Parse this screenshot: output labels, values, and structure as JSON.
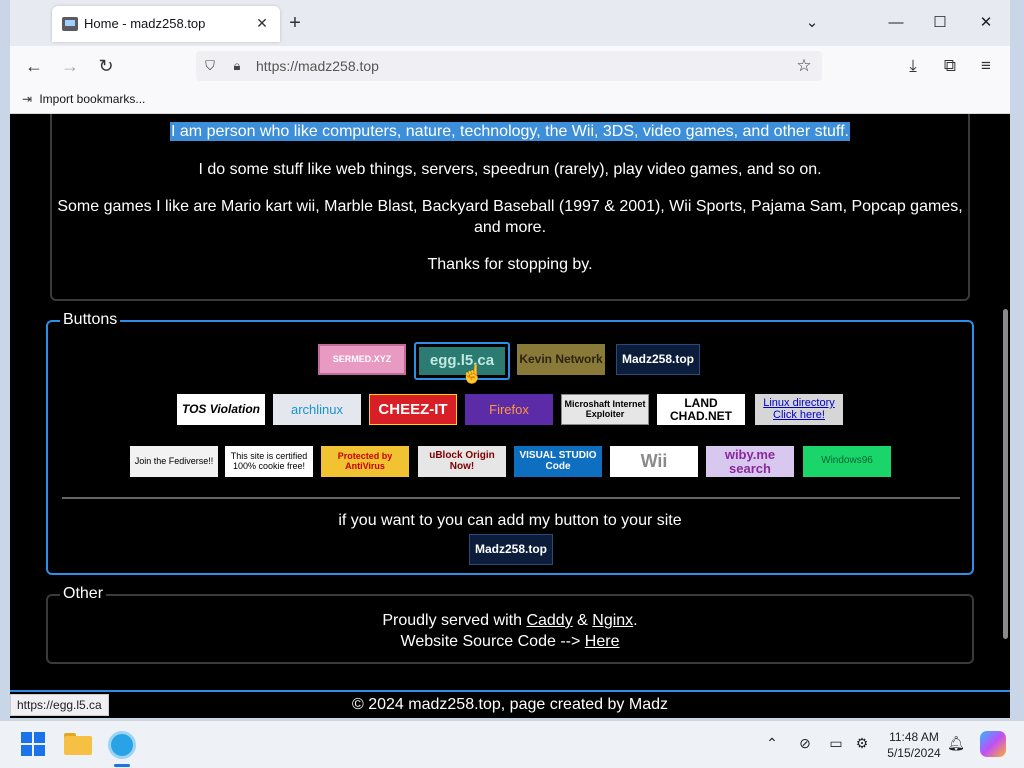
{
  "browser": {
    "tab_title": "Home - madz258.top",
    "tab_close": "✕",
    "new_tab": "+",
    "url": "https://madz258.top",
    "bookmark_item": "Import bookmarks...",
    "window_controls": {
      "list": "⌄",
      "minimize": "—",
      "maximize": "☐",
      "close": "✕"
    },
    "nav": {
      "back": "←",
      "forward": "→",
      "reload": "↻"
    },
    "status_link": "https://egg.l5.ca"
  },
  "page": {
    "about": {
      "line1": "I am person who like computers, nature, technology, the Wii, 3DS, video games, and other stuff.",
      "line2": "I do some stuff like web things, servers, speedrun (rarely), play video games, and so on.",
      "line3a": "Some games I like are Mario kart wii, Marble Blast, Backyard Baseball (1997 & 2001), Wii Sports, Pajama Sam, Popcap games,",
      "line3b": "and more.",
      "line4": "Thanks for stopping by."
    },
    "buttons_section": {
      "legend": "Buttons",
      "row1": [
        "SERMED.XYZ",
        "egg.l5.ca",
        "Kevin Network",
        "Madz258.top"
      ],
      "row2": [
        "TOS Violation",
        "archlinux",
        "CHEEZ-IT",
        "Firefox",
        "Microshaft Internet Exploiter",
        "LAND CHAD.NET",
        "Linux directory Click here!"
      ],
      "row3": [
        "Join the Fediverse!!",
        "This site is certified 100% cookie free!",
        "Protected by AntiVirus",
        "uBlock Origin Now!",
        "VISUAL STUDIO Code",
        "Wii",
        "wiby.me search",
        "Windows96"
      ],
      "add_text": "if you want to you can add my button to your site",
      "own_button": "Madz258.top"
    },
    "other_section": {
      "legend": "Other",
      "served_prefix": "Proudly served with",
      "caddy": "Caddy",
      "amp": "&",
      "nginx": "Nginx",
      "period": ".",
      "source_prefix": "Website Source Code -->",
      "source_link": "Here"
    },
    "footer": "© 2024 madz258.top, page created by Madz"
  },
  "taskbar": {
    "time": "11:48 AM",
    "date": "5/15/2024"
  },
  "colors": {
    "selection": "#3d8fd9",
    "buttons_border": "#2d8fe6",
    "page_bg": "#000000"
  }
}
